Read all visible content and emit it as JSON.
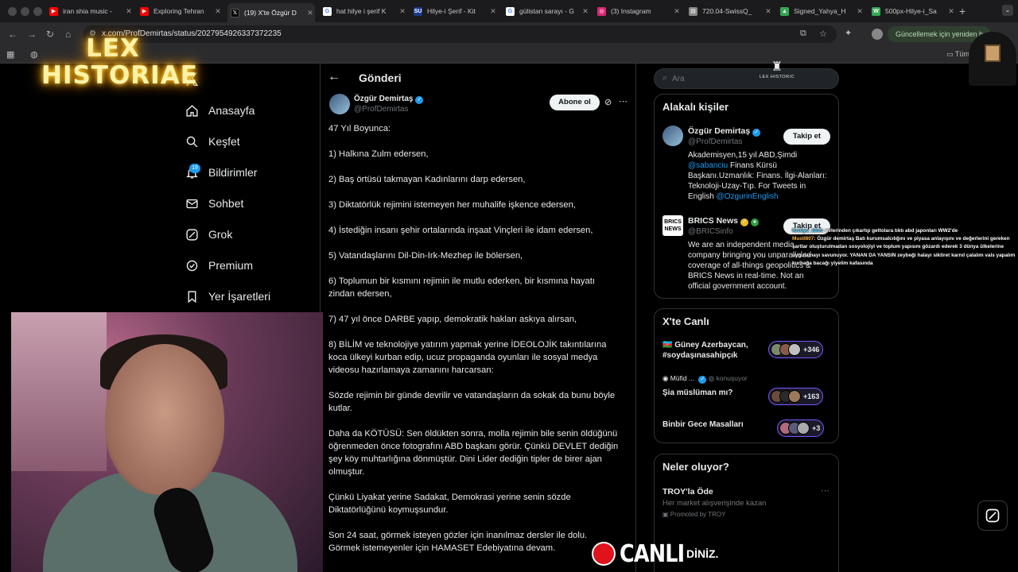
{
  "browser": {
    "tabs": [
      {
        "title": "iran shia music -",
        "favicon": "youtube-icon",
        "color": "#ff0000"
      },
      {
        "title": "Exploring Tehran",
        "favicon": "youtube-icon",
        "color": "#ff0000"
      },
      {
        "title": "(19) X'te Özgür D",
        "favicon": "x-icon",
        "color": "#000000",
        "active": true
      },
      {
        "title": "hat hilye i şerif K",
        "favicon": "google-icon",
        "color": "#4285f4"
      },
      {
        "title": "Hilye-i Şerif - Kit",
        "favicon": "su-icon",
        "color": "#1a3a8a"
      },
      {
        "title": "gülistan sarayı - G",
        "favicon": "google-icon",
        "color": "#4285f4"
      },
      {
        "title": "(3) Instagram",
        "favicon": "instagram-icon",
        "color": "#d62976"
      },
      {
        "title": "720.04-SwissQ_",
        "favicon": "file-icon",
        "color": "#888888"
      },
      {
        "title": "Signed_Yahya_H",
        "favicon": "drive-icon",
        "color": "#34a853"
      },
      {
        "title": "500px-Hilye-i_Sa",
        "favicon": "wiki-icon",
        "color": "#34a853"
      }
    ],
    "url": "x.com/ProfDemirtas/status/2027954926337372235",
    "update_label": "Güncellemek için yeniden b",
    "bookmark_folder": "Tüm"
  },
  "sidebar": {
    "items": [
      {
        "label": "Anasayfa",
        "icon": "home-icon"
      },
      {
        "label": "Keşfet",
        "icon": "search-icon"
      },
      {
        "label": "Bildirimler",
        "icon": "bell-icon",
        "badge": "19"
      },
      {
        "label": "Sohbet",
        "icon": "mail-icon"
      },
      {
        "label": "Grok",
        "icon": "grok-icon"
      },
      {
        "label": "Premium",
        "icon": "premium-icon"
      },
      {
        "label": "Yer İşaretleri",
        "icon": "bookmark-icon"
      }
    ]
  },
  "main": {
    "title": "Gönderi",
    "author": {
      "name": "Özgür Demirtaş",
      "handle": "@ProfDemirtas"
    },
    "subscribe_label": "Abone ol",
    "tweet_lines": [
      "47 Yıl Boyunca:",
      "",
      "1) Halkına Zulm edersen,",
      "",
      "2) Baş örtüsü takmayan Kadınlarını darp edersen,",
      "",
      "3) Diktatörlük rejimini istemeyen her muhalife işkence edersen,",
      "",
      "4) İstediğin insanı şehir ortalarında inşaat Vinçleri ile idam edersen,",
      "",
      "5) Vatandaşlarını Dil-Din-Irk-Mezhep ile bölersen,",
      "",
      "6) Toplumun bir kısmını rejimin ile mutlu ederken, bir kısmına hayatı",
      "zindan edersen,",
      "",
      "7) 47 yıl önce DARBE yapıp, demokratik hakları askıya alırsan,",
      "",
      "8) BİLİM ve teknolojiye yatırım yapmak yerine İDEOLOJİK takıntılarına",
      "koca ülkeyi kurban edip, ucuz propaganda oyunları ile sosyal medya",
      "videosu hazırlamaya zamanını harcarsan:",
      "",
      "Sözde rejimin bir günde devrilir ve vatandaşların da sokak da bunu böyle",
      "kutlar.",
      "",
      "Daha da KÖTÜSÜ: Sen öldükten sonra, molla rejimin bile senin öldüğünü",
      "öğrenmeden önce fotografını ABD başkanı görür. Çünkü DEVLET dediğin",
      "şey köy muhtarlığına dönmüştür. Dini Lider dediğin tipler de birer ajan",
      "olmuştur.",
      "",
      "Çünkü Liyakat yerine Sadakat, Demokrasi yerine senin sözde",
      "Diktatörlüğünü koymuşsundur.",
      "",
      "Son 24 saat, görmek isteyen gözler için inanılmaz dersler ile dolu.",
      "Görmek istemeyenler için HAMASET Edebiyatına devam."
    ]
  },
  "right": {
    "search_placeholder": "Ara",
    "related": {
      "title": "Alakalı kişiler",
      "people": [
        {
          "name": "Özgür Demirtaş",
          "handle": "@ProfDemirtas",
          "follow_label": "Takip et",
          "bio_lines": [
            "Akademisyen,15 yıl ABD,Şimdi",
            "@sabanciu Finans Kürsü",
            "Başkanı.Uzmanlık: Finans. İlgi-Alanları:",
            "Teknoloji-Uzay-Tıp. For Tweets in",
            "English @OzgurinEnglish"
          ]
        },
        {
          "name": "BRICS News",
          "handle": "@BRICSinfo",
          "follow_label": "Takip et",
          "bio_lines": [
            "We are an independent media",
            "company bringing you unparalleled",
            "coverage of all-things geopolitics &",
            "BRICS News in real-time. Not an",
            "official government account."
          ]
        }
      ]
    },
    "live": {
      "title": "X'te Canlı",
      "spaces": [
        {
          "title_lines": [
            "🇦🇿 Güney Azerbaycan,",
            "#soydaşınasahipçık"
          ],
          "count": "+346"
        },
        {
          "host": "Müfid ...",
          "host_status": "konuşuyor",
          "title_lines": [
            "Şia müslüman mı?"
          ],
          "count": "+163"
        },
        {
          "title_lines": [
            "Binbir Gece Masalları"
          ],
          "count": "+3"
        }
      ]
    },
    "news": {
      "title": "Neler oluyor?",
      "items": [
        {
          "title": "TROY'la Öde",
          "subtitle": "Her market alışverişinde kazan",
          "promo": "Promoted by TROY"
        }
      ]
    }
  },
  "overlay": {
    "stream_logo_lines": [
      "LEX",
      "HISTORIAE"
    ],
    "watermark": "LEX HISTORIC",
    "live_label": "CANLI",
    "live_suffix": "DİNİZ.",
    "chat": [
      {
        "user": "fostiyu_ldnh",
        "msg": ": evlerinden çıkartıp gettolara tıktı abd japonları WW2'de"
      },
      {
        "user": "Mustl807",
        "msg": ": Özgür demirtaş Batı kurumsalcılığını ve piyasa anlayışını ve değerlerini gereken şartlar oluşturulmadan sosyolojiyi ve toplum yapısını gözardı ederek 3 dünya ülkelerine uygulamayı savunuyor. YANAN DA YANSIN zeybeği halayı siktiret karnıl çalalım vals yapalım kurbağa bacağı yiyelim kafasında"
      }
    ]
  },
  "colors": {
    "accent": "#1d9bf0",
    "live_red": "#e0121b",
    "logo_glow": "#ffb000",
    "space_purple": "#7856ff"
  }
}
